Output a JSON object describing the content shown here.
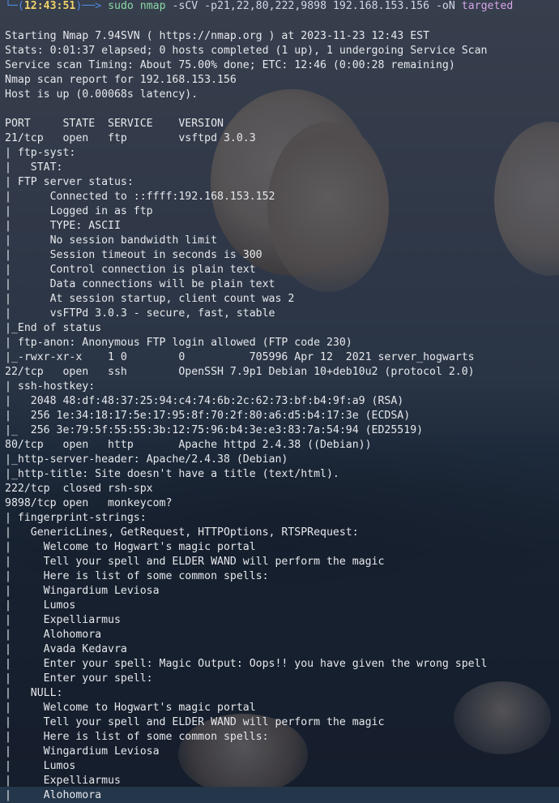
{
  "prompt": {
    "prefix": "└─(",
    "time": "12:43:51",
    "suffix": ")──> ",
    "cmd_name": "sudo nmap",
    "cmd_args": " -sCV -p21,22,80,222,9898 192.168.153.156 -oN ",
    "target": "targeted"
  },
  "lines": [
    "Starting Nmap 7.94SVN ( https://nmap.org ) at 2023-11-23 12:43 EST",
    "Stats: 0:01:37 elapsed; 0 hosts completed (1 up), 1 undergoing Service Scan",
    "Service scan Timing: About 75.00% done; ETC: 12:46 (0:00:28 remaining)",
    "Nmap scan report for 192.168.153.156",
    "Host is up (0.00068s latency).",
    "",
    "PORT     STATE  SERVICE    VERSION",
    "21/tcp   open   ftp        vsftpd 3.0.3",
    "| ftp-syst:",
    "|   STAT:",
    "| FTP server status:",
    "|      Connected to ::ffff:192.168.153.152",
    "|      Logged in as ftp",
    "|      TYPE: ASCII",
    "|      No session bandwidth limit",
    "|      Session timeout in seconds is 300",
    "|      Control connection is plain text",
    "|      Data connections will be plain text",
    "|      At session startup, client count was 2",
    "|      vsFTPd 3.0.3 - secure, fast, stable",
    "|_End of status",
    "| ftp-anon: Anonymous FTP login allowed (FTP code 230)",
    "|_-rwxr-xr-x    1 0        0          705996 Apr 12  2021 server_hogwarts",
    "22/tcp   open   ssh        OpenSSH 7.9p1 Debian 10+deb10u2 (protocol 2.0)",
    "| ssh-hostkey:",
    "|   2048 48:df:48:37:25:94:c4:74:6b:2c:62:73:bf:b4:9f:a9 (RSA)",
    "|   256 1e:34:18:17:5e:17:95:8f:70:2f:80:a6:d5:b4:17:3e (ECDSA)",
    "|_  256 3e:79:5f:55:55:3b:12:75:96:b4:3e:e3:83:7a:54:94 (ED25519)",
    "80/tcp   open   http       Apache httpd 2.4.38 ((Debian))",
    "|_http-server-header: Apache/2.4.38 (Debian)",
    "|_http-title: Site doesn't have a title (text/html).",
    "222/tcp  closed rsh-spx",
    "9898/tcp open   monkeycom?",
    "| fingerprint-strings:",
    "|   GenericLines, GetRequest, HTTPOptions, RTSPRequest:",
    "|     Welcome to Hogwart's magic portal",
    "|     Tell your spell and ELDER WAND will perform the magic",
    "|     Here is list of some common spells:",
    "|     Wingardium Leviosa",
    "|     Lumos",
    "|     Expelliarmus",
    "|     Alohomora",
    "|     Avada Kedavra",
    "|     Enter your spell: Magic Output: Oops!! you have given the wrong spell",
    "|     Enter your spell:",
    "|   NULL:",
    "|     Welcome to Hogwart's magic portal",
    "|     Tell your spell and ELDER WAND will perform the magic",
    "|     Here is list of some common spells:",
    "|     Wingardium Leviosa",
    "|     Lumos",
    "|     Expelliarmus",
    "|     Alohomora"
  ]
}
